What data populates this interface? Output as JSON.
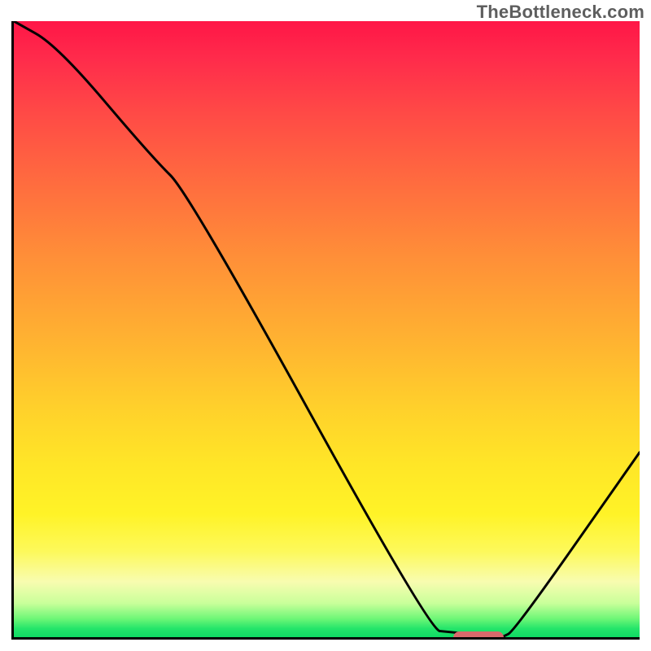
{
  "watermark": "TheBottleneck.com",
  "colors": {
    "axis": "#000000",
    "curve": "#000000",
    "marker": "#d86a6c",
    "gradient_top": "#ff1647",
    "gradient_bottom": "#0fd964"
  },
  "chart_data": {
    "type": "line",
    "title": "",
    "xlabel": "",
    "ylabel": "",
    "xlim": [
      0,
      100
    ],
    "ylim": [
      0,
      100
    ],
    "grid": false,
    "legend": false,
    "series": [
      {
        "name": "bottleneck-curve",
        "x": [
          0,
          7,
          22,
          28,
          66,
          70,
          78,
          80,
          100
        ],
        "values": [
          100,
          96,
          78,
          72,
          2,
          0,
          0,
          1,
          30
        ]
      }
    ],
    "annotations": [
      {
        "name": "optimal-range-marker",
        "x_start": 70,
        "x_end": 78,
        "y": 0
      }
    ]
  }
}
